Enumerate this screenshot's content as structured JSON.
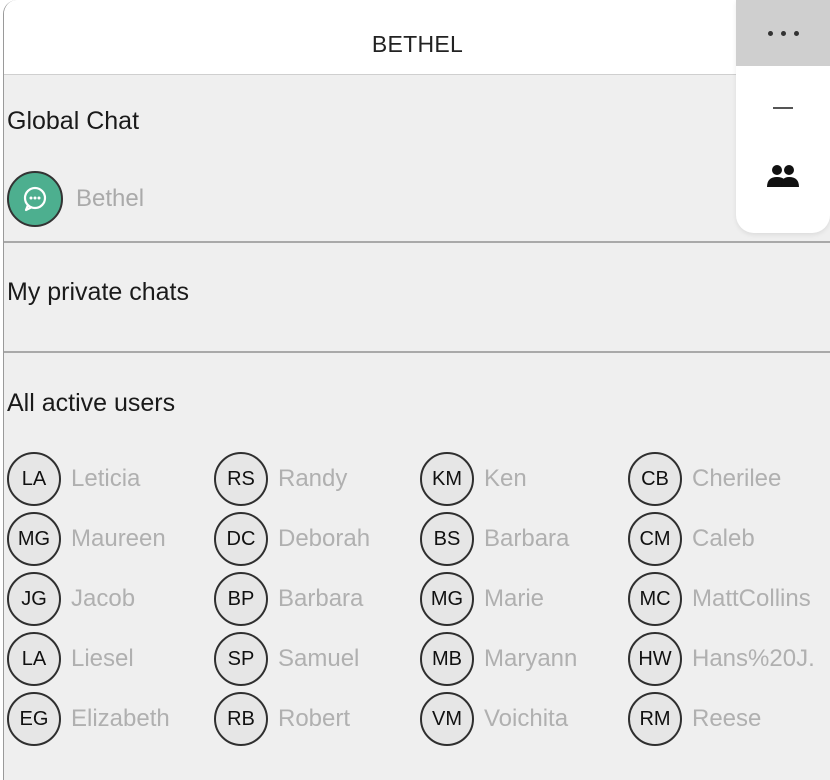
{
  "header": {
    "title": "BETHEL"
  },
  "global_chat": {
    "title": "Global Chat",
    "chat_name": "Bethel",
    "accent": "#4daf8f"
  },
  "private_chats": {
    "title": "My private chats"
  },
  "active_users": {
    "title": "All active users",
    "users": [
      {
        "initials": "LA",
        "name": "Leticia"
      },
      {
        "initials": "RS",
        "name": "Randy"
      },
      {
        "initials": "KM",
        "name": "Ken"
      },
      {
        "initials": "CB",
        "name": "Cherilee"
      },
      {
        "initials": "MG",
        "name": "Maureen"
      },
      {
        "initials": "DC",
        "name": "Deborah"
      },
      {
        "initials": "BS",
        "name": "Barbara"
      },
      {
        "initials": "CM",
        "name": "Caleb"
      },
      {
        "initials": "JG",
        "name": "Jacob"
      },
      {
        "initials": "BP",
        "name": "Barbara"
      },
      {
        "initials": "MG",
        "name": "Marie"
      },
      {
        "initials": "MC",
        "name": "MattCollins"
      },
      {
        "initials": "LA",
        "name": "Liesel"
      },
      {
        "initials": "SP",
        "name": "Samuel"
      },
      {
        "initials": "MB",
        "name": "Maryann"
      },
      {
        "initials": "HW",
        "name": "Hans%20J."
      },
      {
        "initials": "EG",
        "name": "Elizabeth"
      },
      {
        "initials": "RB",
        "name": "Robert"
      },
      {
        "initials": "VM",
        "name": "Voichita"
      },
      {
        "initials": "RM",
        "name": "Reese"
      }
    ]
  },
  "sidebar": {
    "icons": [
      "more-icon",
      "minimize-icon",
      "users-icon"
    ]
  }
}
